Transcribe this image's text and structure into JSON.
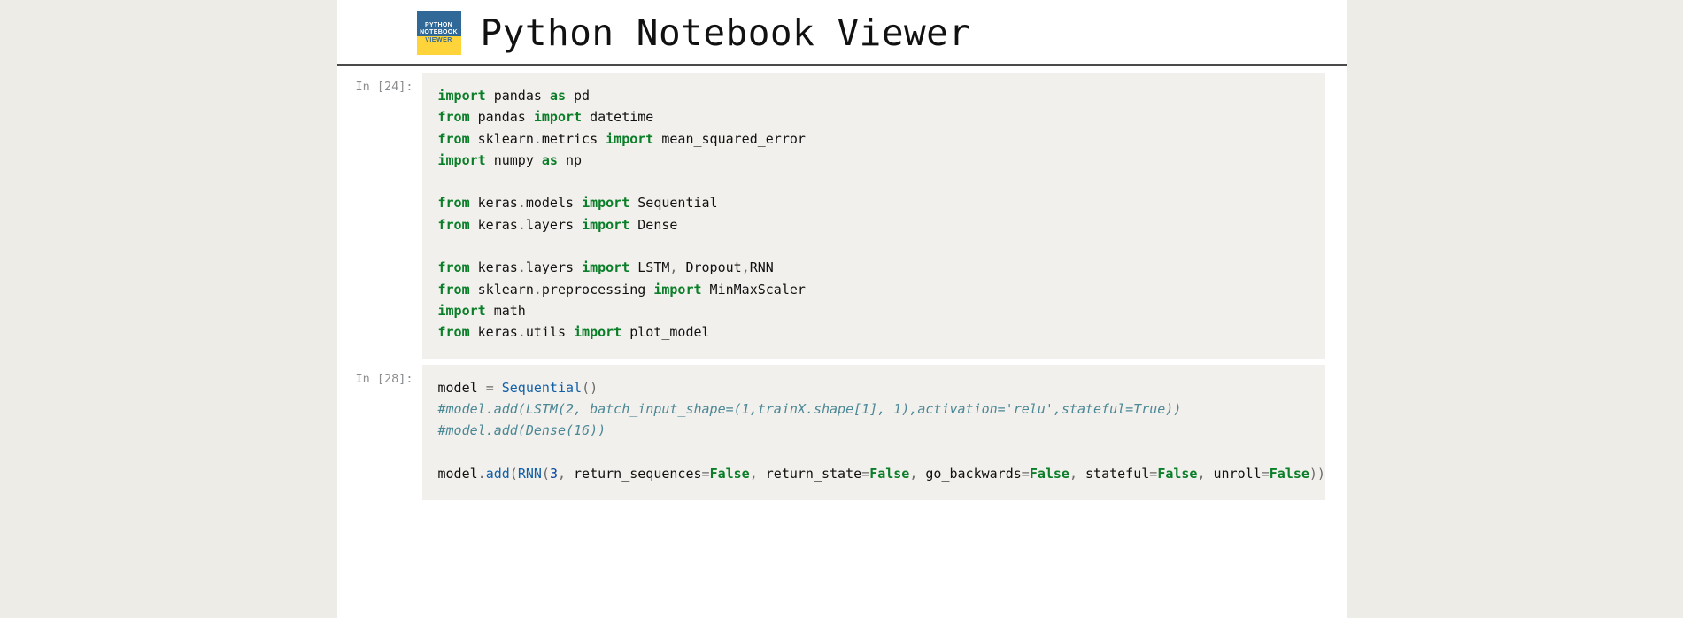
{
  "logo": {
    "line1": "PYTHON",
    "line2": "NOTEBOOK",
    "line3": "VIEWER"
  },
  "app_title": "Python Notebook Viewer",
  "cells": [
    {
      "prompt": "In [24]:",
      "code": [
        [
          {
            "cls": "kw",
            "t": "import"
          },
          {
            "t": " pandas "
          },
          {
            "cls": "kw",
            "t": "as"
          },
          {
            "t": " pd"
          }
        ],
        [
          {
            "cls": "kw",
            "t": "from"
          },
          {
            "t": " pandas "
          },
          {
            "cls": "kw",
            "t": "import"
          },
          {
            "t": " datetime"
          }
        ],
        [
          {
            "cls": "kw",
            "t": "from"
          },
          {
            "t": " sklearn"
          },
          {
            "cls": "op",
            "t": "."
          },
          {
            "t": "metrics "
          },
          {
            "cls": "kw",
            "t": "import"
          },
          {
            "t": " mean_squared_error"
          }
        ],
        [
          {
            "cls": "kw",
            "t": "import"
          },
          {
            "t": " numpy "
          },
          {
            "cls": "kw",
            "t": "as"
          },
          {
            "t": " np"
          }
        ],
        [
          {
            "t": ""
          }
        ],
        [
          {
            "cls": "kw",
            "t": "from"
          },
          {
            "t": " keras"
          },
          {
            "cls": "op",
            "t": "."
          },
          {
            "t": "models "
          },
          {
            "cls": "kw",
            "t": "import"
          },
          {
            "t": " Sequential"
          }
        ],
        [
          {
            "cls": "kw",
            "t": "from"
          },
          {
            "t": " keras"
          },
          {
            "cls": "op",
            "t": "."
          },
          {
            "t": "layers "
          },
          {
            "cls": "kw",
            "t": "import"
          },
          {
            "t": " Dense"
          }
        ],
        [
          {
            "t": ""
          }
        ],
        [
          {
            "cls": "kw",
            "t": "from"
          },
          {
            "t": " keras"
          },
          {
            "cls": "op",
            "t": "."
          },
          {
            "t": "layers "
          },
          {
            "cls": "kw",
            "t": "import"
          },
          {
            "t": " LSTM"
          },
          {
            "cls": "op",
            "t": ","
          },
          {
            "t": " Dropout"
          },
          {
            "cls": "op",
            "t": ","
          },
          {
            "t": "RNN"
          }
        ],
        [
          {
            "cls": "kw",
            "t": "from"
          },
          {
            "t": " sklearn"
          },
          {
            "cls": "op",
            "t": "."
          },
          {
            "t": "preprocessing "
          },
          {
            "cls": "kw",
            "t": "import"
          },
          {
            "t": " MinMaxScaler"
          }
        ],
        [
          {
            "cls": "kw",
            "t": "import"
          },
          {
            "t": " math"
          }
        ],
        [
          {
            "cls": "kw",
            "t": "from"
          },
          {
            "t": " keras"
          },
          {
            "cls": "op",
            "t": "."
          },
          {
            "t": "utils "
          },
          {
            "cls": "kw",
            "t": "import"
          },
          {
            "t": " plot_model"
          }
        ]
      ]
    },
    {
      "prompt": "In [28]:",
      "code": [
        [
          {
            "t": "model "
          },
          {
            "cls": "op",
            "t": "="
          },
          {
            "t": " "
          },
          {
            "cls": "fn",
            "t": "Sequential"
          },
          {
            "cls": "op",
            "t": "()"
          }
        ],
        [
          {
            "cls": "cm",
            "t": "#model.add(LSTM(2, batch_input_shape=(1,trainX.shape[1], 1),activation='relu',stateful=True))"
          }
        ],
        [
          {
            "cls": "cm",
            "t": "#model.add(Dense(16))"
          }
        ],
        [
          {
            "t": ""
          }
        ],
        [
          {
            "t": "model"
          },
          {
            "cls": "op",
            "t": "."
          },
          {
            "cls": "fn",
            "t": "add"
          },
          {
            "cls": "op",
            "t": "("
          },
          {
            "cls": "fn",
            "t": "RNN"
          },
          {
            "cls": "op",
            "t": "("
          },
          {
            "cls": "nm",
            "t": "3"
          },
          {
            "cls": "op",
            "t": ","
          },
          {
            "t": " "
          },
          {
            "cls": "kv",
            "t": "return_sequences"
          },
          {
            "cls": "op",
            "t": "="
          },
          {
            "cls": "bl",
            "t": "False"
          },
          {
            "cls": "op",
            "t": ","
          },
          {
            "t": " "
          },
          {
            "cls": "kv",
            "t": "return_state"
          },
          {
            "cls": "op",
            "t": "="
          },
          {
            "cls": "bl",
            "t": "False"
          },
          {
            "cls": "op",
            "t": ","
          },
          {
            "t": " "
          },
          {
            "cls": "kv",
            "t": "go_backwards"
          },
          {
            "cls": "op",
            "t": "="
          },
          {
            "cls": "bl",
            "t": "False"
          },
          {
            "cls": "op",
            "t": ","
          },
          {
            "t": " "
          },
          {
            "cls": "kv",
            "t": "stateful"
          },
          {
            "cls": "op",
            "t": "="
          },
          {
            "cls": "bl",
            "t": "False"
          },
          {
            "cls": "op",
            "t": ","
          },
          {
            "t": " "
          },
          {
            "cls": "kv",
            "t": "unroll"
          },
          {
            "cls": "op",
            "t": "="
          },
          {
            "cls": "bl",
            "t": "False"
          },
          {
            "cls": "op",
            "t": "))"
          }
        ]
      ]
    }
  ]
}
